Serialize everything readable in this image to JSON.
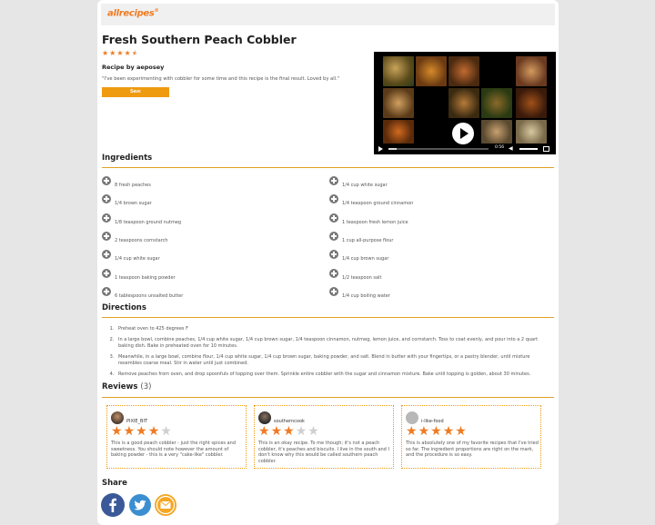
{
  "header": {
    "logo": "allrecipes"
  },
  "recipe": {
    "title": "Fresh Southern Peach Cobbler",
    "rating_stars": 4.5,
    "byline": "Recipe by aeposey",
    "description": "\"I've been experimenting with cobbler for some time and this recipe is the final result. Loved by all.\"",
    "save_label": "Save"
  },
  "video": {
    "time": "0:56"
  },
  "ingredients": {
    "heading": "Ingredients",
    "left": [
      "8 fresh peaches",
      "1/4 brown sugar",
      "1/8 teaspoon ground nutmeg",
      "2 teaspoons cornstarch",
      "1/4 cup white sugar",
      "1 teaspoon baking powder",
      "6 tablespoons unsalted butter"
    ],
    "right": [
      "1/4 cup white sugar",
      "1/4 teaspoon ground cinnamon",
      "1 teaspoon fresh lemon juice",
      "1 cup all-purpose flour",
      "1/4 cup brown sugar",
      "1/2 teaspoon salt",
      "1/4 cup boiling water"
    ]
  },
  "directions": {
    "heading": "Directions",
    "steps": [
      "Preheat oven to 425 degrees F",
      "In a large bowl, combine peaches, 1/4 cup white sugar, 1/4 cup brown sugar, 1/4 teaspoon cinnamon, nutmeg, lemon juice, and cornstarch. Toss to coat evenly, and pour into a 2 quart baking dish. Bake in preheated oven for 10 minutes.",
      "Meanwhile, in a large bowl, combine flour, 1/4 cup white sugar, 1/4 cup brown sugar, baking powder, and salt. Blend in butter with your fingertips, or a pastry blender, until mixture resembles coarse meal. Stir in water until just combined.",
      "Remove peaches from oven, and drop spoonfuls of topping over them. Sprinkle entire cobbler with the sugar and cinnamon mixture. Bake until topping is golden, about 30 minutes."
    ]
  },
  "reviews": {
    "heading": "Reviews",
    "count": "(3)",
    "items": [
      {
        "user": "PIXIE_BIT",
        "stars": 4,
        "text": "This is a good peach cobbler - just the right spices and sweetness. You should note however the amount of baking powder - this is a very \"cake-like\" cobbler."
      },
      {
        "user": "southerncook",
        "stars": 3,
        "text": "This is an okay recipe. To me though; it's not a peach cobbler, it's peaches and biscuits. I live in the south and I don't know why this would be called southern peach cobbler."
      },
      {
        "user": "i-like-food",
        "stars": 5,
        "text": "This is absolutely one of my favorite recipes that I've tried so far. The ingredient proportions are right on the mark, and the procedure is so easy."
      }
    ]
  },
  "share": {
    "heading": "Share"
  },
  "colors": {
    "accent": "#ef7b22",
    "rule": "#e0a124",
    "facebook": "#3b5998",
    "twitter": "#3b8fd0"
  }
}
